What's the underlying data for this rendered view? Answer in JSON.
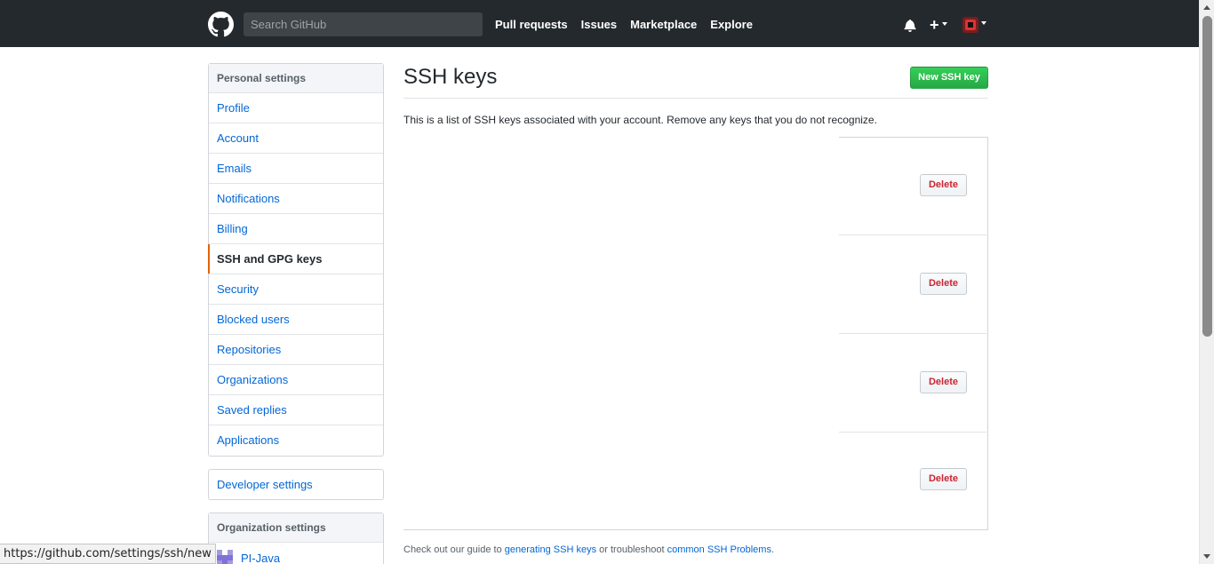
{
  "header": {
    "search_placeholder": "Search GitHub",
    "nav": [
      "Pull requests",
      "Issues",
      "Marketplace",
      "Explore"
    ],
    "icons": [
      "github-logo-icon",
      "bell-icon",
      "plus-icon",
      "avatar"
    ]
  },
  "sidebar": {
    "personal_heading": "Personal settings",
    "items": [
      {
        "label": "Profile"
      },
      {
        "label": "Account"
      },
      {
        "label": "Emails"
      },
      {
        "label": "Notifications"
      },
      {
        "label": "Billing"
      },
      {
        "label": "SSH and GPG keys",
        "selected": true
      },
      {
        "label": "Security"
      },
      {
        "label": "Blocked users"
      },
      {
        "label": "Repositories"
      },
      {
        "label": "Organizations"
      },
      {
        "label": "Saved replies"
      },
      {
        "label": "Applications"
      }
    ],
    "developer_settings": "Developer settings",
    "org_heading": "Organization settings",
    "org_items": [
      {
        "label": "PI-Java"
      }
    ]
  },
  "main": {
    "title": "SSH keys",
    "new_key_button": "New SSH key",
    "intro": "This is a list of SSH keys associated with your account. Remove any keys that you do not recognize.",
    "keys": [
      {
        "delete_label": "Delete"
      },
      {
        "delete_label": "Delete"
      },
      {
        "delete_label": "Delete"
      },
      {
        "delete_label": "Delete"
      }
    ],
    "footer": {
      "prefix": "Check out our guide to ",
      "link1": "generating SSH keys",
      "middle": " or troubleshoot ",
      "link2": "common SSH Problems",
      "suffix": "."
    }
  },
  "status_bar": {
    "url": "https://github.com/settings/ssh/new"
  },
  "colors": {
    "header_bg": "#24292e",
    "link": "#0366d6",
    "primary_button": "#28a745",
    "danger_text": "#cb2431",
    "selected_marker": "#e36209"
  }
}
